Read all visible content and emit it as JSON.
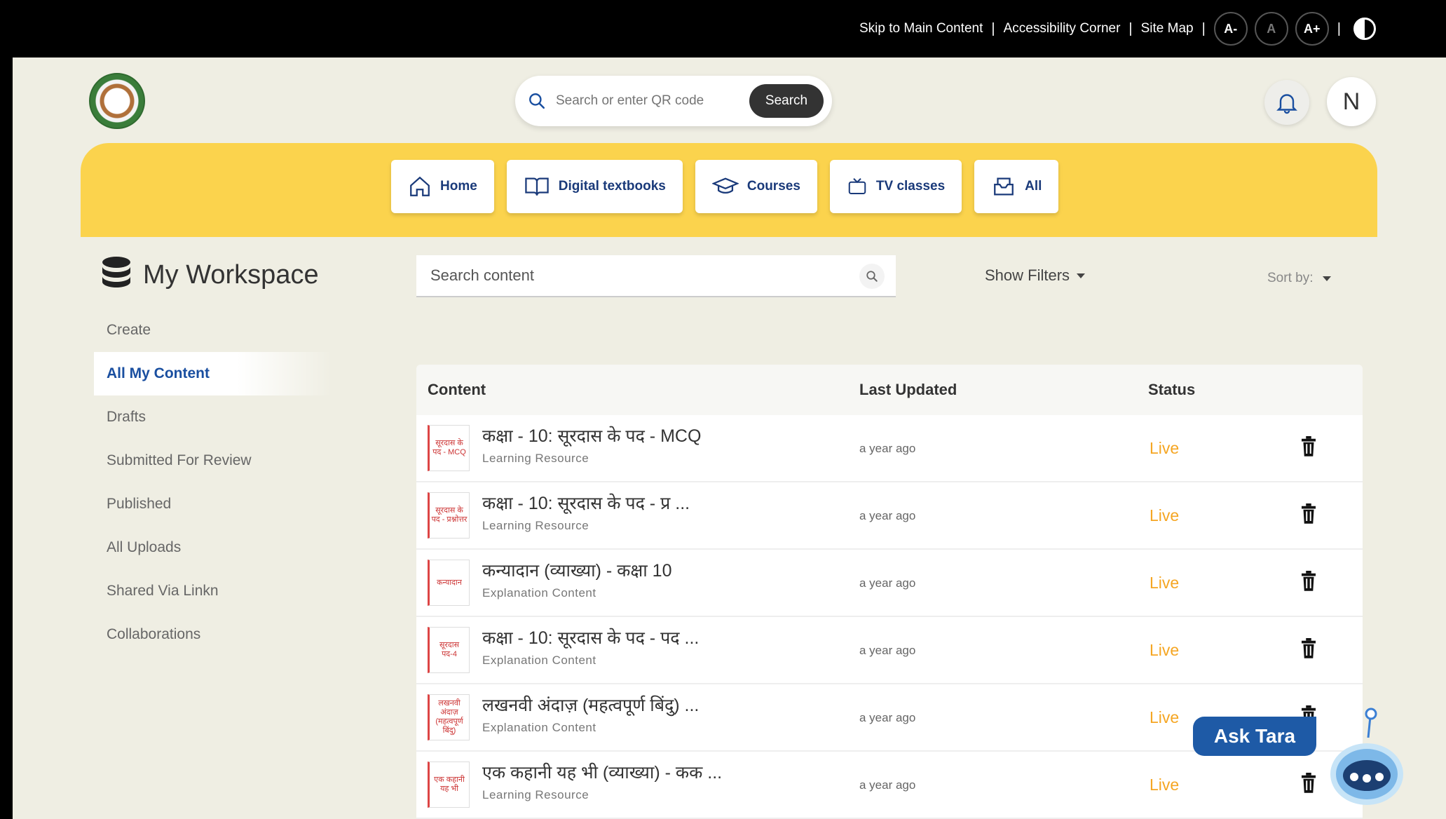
{
  "topbar": {
    "skip_link": "Skip to Main Content",
    "accessibility_link": "Accessibility Corner",
    "sitemap_link": "Site Map",
    "sep": "|",
    "font_decrease": "A-",
    "font_normal": "A",
    "font_increase": "A+"
  },
  "header": {
    "search_placeholder": "Search or enter QR code",
    "search_button": "Search",
    "avatar_initial": "N"
  },
  "nav": {
    "items": [
      {
        "label": "Home",
        "icon": "home-icon"
      },
      {
        "label": "Digital textbooks",
        "icon": "book-icon"
      },
      {
        "label": "Courses",
        "icon": "graduation-cap-icon"
      },
      {
        "label": "TV classes",
        "icon": "tv-icon"
      },
      {
        "label": "All",
        "icon": "inbox-icon"
      }
    ]
  },
  "workspace": {
    "title": "My Workspace",
    "menu": [
      "Create",
      "All My Content",
      "Drafts",
      "Submitted For Review",
      "Published",
      "All Uploads",
      "Shared Via Linkn",
      "Collaborations"
    ],
    "active_index": 1,
    "search_placeholder": "Search content",
    "show_filters": "Show Filters",
    "sort_by": "Sort by:"
  },
  "table": {
    "headers": {
      "content": "Content",
      "last_updated": "Last Updated",
      "status": "Status"
    },
    "rows": [
      {
        "thumb": "सूरदास के पद - MCQ",
        "title": "कक्षा - 10: सूरदास के पद - MCQ",
        "type": "Learning Resource",
        "updated": "a year ago",
        "status": "Live"
      },
      {
        "thumb": "सूरदास के पद - प्रश्नोत्तर",
        "title": "कक्षा - 10: सूरदास के पद - प्र ...",
        "type": "Learning Resource",
        "updated": "a year ago",
        "status": "Live"
      },
      {
        "thumb": "कन्यादान",
        "title": "कन्यादान (व्याख्या) - कक्षा 10",
        "type": "Explanation Content",
        "updated": "a year ago",
        "status": "Live"
      },
      {
        "thumb": "सूरदास पद-4",
        "title": "कक्षा - 10: सूरदास के पद - पद ...",
        "type": "Explanation Content",
        "updated": "a year ago",
        "status": "Live"
      },
      {
        "thumb": "लखनवी अंदाज़ (महत्वपूर्ण बिंदु)",
        "title": "लखनवी अंदाज़ (महत्वपूर्ण बिंदु) ...",
        "type": "Explanation Content",
        "updated": "a year ago",
        "status": "Live"
      },
      {
        "thumb": "एक कहानी यह भी",
        "title": "एक कहानी यह भी (व्याख्या) - कक ...",
        "type": "Learning Resource",
        "updated": "a year ago",
        "status": "Live"
      }
    ]
  },
  "assistant": {
    "label": "Ask Tara"
  },
  "colors": {
    "accent_yellow": "#fbd34d",
    "status_live": "#f5a623",
    "active_blue": "#1a4fa0",
    "tara_blue": "#1e5aa6"
  }
}
